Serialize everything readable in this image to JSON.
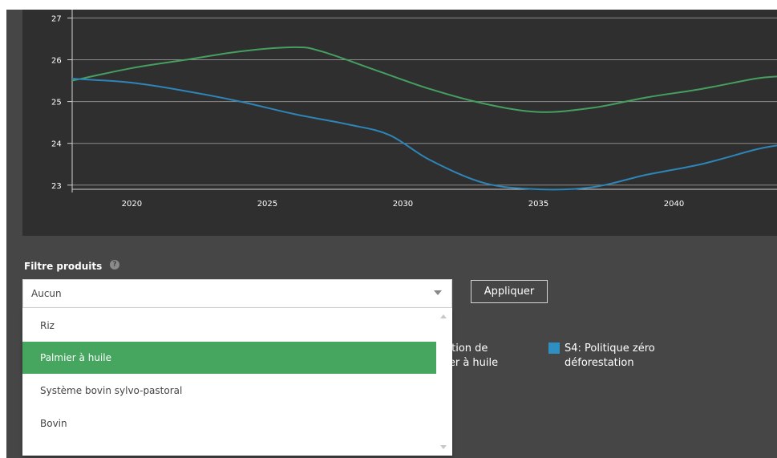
{
  "chart_data": {
    "type": "line",
    "x_ticks": [
      "2020",
      "2025",
      "2030",
      "2035",
      "2040"
    ],
    "y_ticks": [
      "23",
      "24",
      "25",
      "26",
      "27"
    ],
    "xlim": [
      2017.8,
      2043.8
    ],
    "ylim": [
      22.9,
      27.2
    ],
    "grid": true,
    "series": [
      {
        "color": "#45a060",
        "x": [
          2017.8,
          2020,
          2022,
          2024,
          2026,
          2027,
          2029,
          2031,
          2033,
          2035,
          2037,
          2039,
          2041,
          2043,
          2043.8
        ],
        "y": [
          25.5,
          25.8,
          26.0,
          26.2,
          26.3,
          26.2,
          25.75,
          25.3,
          24.95,
          24.75,
          24.85,
          25.1,
          25.3,
          25.55,
          25.6
        ]
      },
      {
        "color": "#2e85b8",
        "x": [
          2017.8,
          2020,
          2022,
          2024,
          2026,
          2028,
          2029.5,
          2031,
          2033,
          2035,
          2037,
          2039,
          2041,
          2043,
          2043.8
        ],
        "y": [
          25.55,
          25.45,
          25.25,
          25.0,
          24.7,
          24.45,
          24.2,
          23.6,
          23.05,
          22.9,
          22.95,
          23.25,
          23.5,
          23.85,
          23.95
        ]
      }
    ]
  },
  "filter": {
    "title": "Filtre produits",
    "help_icon": "?",
    "selected": "Aucun",
    "apply_label": "Appliquer",
    "options": [
      "Riz",
      "Palmier à huile",
      "Système bovin sylvo-pastoral",
      "Bovin"
    ],
    "highlighted_option": "Palmier à huile"
  },
  "legend": {
    "partial_line1": "cation de",
    "partial_line2": "nier à huile",
    "s4_line1": "S4: Politique zéro",
    "s4_line2": "déforestation",
    "s4_color": "#2e8fc2"
  }
}
